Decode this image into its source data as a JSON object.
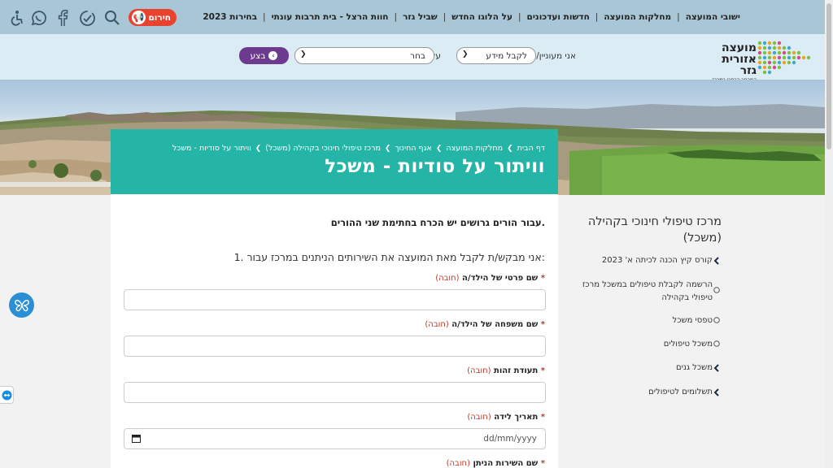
{
  "topnav": {
    "items": [
      "ישובי המועצה",
      "מחלקות המועצה",
      "חדשות ועדכונים",
      "על הלוגו החדש",
      "שביל גזר",
      "חוות הרצל - בית תרבות עונתי",
      "בחירות 2023"
    ],
    "alarm_label": "חירום",
    "icons": [
      "search-icon",
      "accessibility-clock-icon",
      "facebook-icon",
      "whatsapp-icon",
      "accessibility-icon"
    ]
  },
  "logo": {
    "line1": "מועצה",
    "line2": "אזורית גזר",
    "line3": "המרחב הכפרי במרכז"
  },
  "filter": {
    "label_interested": "אני מעוניין/ת",
    "topic_value": "לקבל מידע",
    "label_about": "על",
    "subject_value": "בחר",
    "go_label": "בצע"
  },
  "breadcrumb": [
    "דף הבית",
    "מחלקות המועצה",
    "אגף החינוך",
    "מרכז טיפולי חינוכי בקהילה (משכל)",
    "וויתור על סודיות - משכל"
  ],
  "page_title": "וויתור על סודיות - משכל",
  "form": {
    "note": "עבור הורים גרושים יש הכרח בחתימת שני ההורים.",
    "question1": "1. אני מבקש/ת לקבל מאת המועצה את השירותים הניתנים במרכז עבור:",
    "required_text": "(חובה)",
    "fields": [
      {
        "label": "שם פרטי של הילד/ה"
      },
      {
        "label": "שם משפחה של הילד/ה"
      },
      {
        "label": "תעודת זהות"
      },
      {
        "label": "תאריך לידה",
        "placeholder": "dd/mm/yyyy"
      },
      {
        "label": "שם השירות הניתן"
      }
    ]
  },
  "sidebar": {
    "title": "מרכז טיפולי חינוכי בקהילה (משכל)",
    "items": [
      {
        "label": "קורס קיץ הכנה לכיתה א' 2023",
        "marker": "chevron"
      },
      {
        "label_line1": "הרשמה לקבלת טיפולים במשכל מרכז",
        "label_line2": "טיפולי בקהילה",
        "marker": "circle"
      },
      {
        "label": "טפסי משכל",
        "marker": "circle"
      },
      {
        "label": "משכל טיפולים",
        "marker": "circle"
      },
      {
        "label": "משכל גנים",
        "marker": "chevron"
      },
      {
        "label": "תשלומים לטיפולים",
        "marker": "chevron"
      }
    ]
  },
  "colors": {
    "topbar": "#a9c6d6",
    "header": "#dcecf4",
    "title_box": "#25b5a6",
    "go_button": "#6c3b8f",
    "alarm": "#e8432f"
  }
}
